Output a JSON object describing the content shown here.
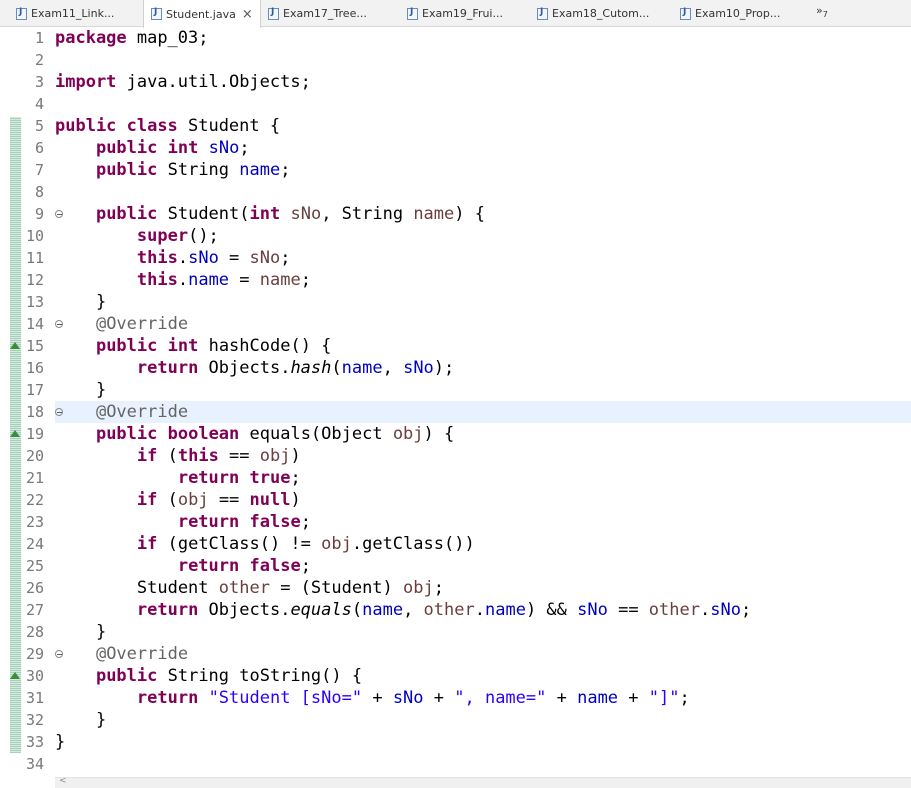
{
  "tabs": [
    {
      "label": "Exam11_Link...",
      "active": false
    },
    {
      "label": "Student.java",
      "active": true
    },
    {
      "label": "Exam17_Tree...",
      "active": false
    },
    {
      "label": "Exam19_Frui...",
      "active": false
    },
    {
      "label": "Exam18_Cutom...",
      "active": false
    },
    {
      "label": "Exam10_Prop...",
      "active": false
    }
  ],
  "overflow": {
    "symbol": "»",
    "count": "7"
  },
  "close_symbol": "×",
  "colors": {
    "keyword": "#7f0055",
    "field": "#0000c0",
    "local_variable": "#6a3e3e",
    "annotation": "#646464",
    "string": "#2a00ff",
    "current_line": "#e8f2fe",
    "change_bar": "#a8cfbe"
  },
  "editor": {
    "current_line_number": 18,
    "lines": [
      {
        "n": "1",
        "tokens": [
          [
            "kw",
            "package"
          ],
          [
            "",
            "map_03;"
          ]
        ]
      },
      {
        "n": "2",
        "tokens": []
      },
      {
        "n": "3",
        "tokens": [
          [
            "kw",
            "import"
          ],
          [
            "",
            "java.util.Objects;"
          ]
        ]
      },
      {
        "n": "4",
        "tokens": []
      },
      {
        "n": "5",
        "tokens": [
          [
            "kw",
            "public"
          ],
          [
            "",
            ""
          ],
          [
            "kw",
            "class"
          ],
          [
            "",
            "Student {"
          ]
        ]
      },
      {
        "n": "6",
        "tokens": [
          [
            "",
            "    "
          ],
          [
            "kw",
            "public"
          ],
          [
            "",
            " "
          ],
          [
            "kw",
            "int"
          ],
          [
            "",
            " "
          ],
          [
            "fld",
            "sNo"
          ],
          [
            "",
            ";"
          ]
        ]
      },
      {
        "n": "7",
        "tokens": [
          [
            "",
            "    "
          ],
          [
            "kw",
            "public"
          ],
          [
            "",
            " String "
          ],
          [
            "fld",
            "name"
          ],
          [
            "",
            ";"
          ]
        ]
      },
      {
        "n": "8",
        "tokens": []
      },
      {
        "n": "9",
        "fold": true,
        "tokens": [
          [
            "",
            "    "
          ],
          [
            "kw",
            "public"
          ],
          [
            "",
            " Student("
          ],
          [
            "kw",
            "int"
          ],
          [
            "",
            " "
          ],
          [
            "var",
            "sNo"
          ],
          [
            "",
            ", String "
          ],
          [
            "var",
            "name"
          ],
          [
            "",
            ") {"
          ]
        ]
      },
      {
        "n": "10",
        "tokens": [
          [
            "",
            "        "
          ],
          [
            "kw",
            "super"
          ],
          [
            "",
            "();"
          ]
        ]
      },
      {
        "n": "11",
        "tokens": [
          [
            "",
            "        "
          ],
          [
            "kw",
            "this"
          ],
          [
            "",
            "."
          ],
          [
            "fld",
            "sNo"
          ],
          [
            "",
            " = "
          ],
          [
            "var",
            "sNo"
          ],
          [
            "",
            ";"
          ]
        ]
      },
      {
        "n": "12",
        "tokens": [
          [
            "",
            "        "
          ],
          [
            "kw",
            "this"
          ],
          [
            "",
            "."
          ],
          [
            "fld",
            "name"
          ],
          [
            "",
            " = "
          ],
          [
            "var",
            "name"
          ],
          [
            "",
            ";"
          ]
        ]
      },
      {
        "n": "13",
        "tokens": [
          [
            "",
            "    }"
          ]
        ]
      },
      {
        "n": "14",
        "fold": true,
        "tokens": [
          [
            "",
            "    "
          ],
          [
            "ann",
            "@Override"
          ]
        ]
      },
      {
        "n": "15",
        "override": true,
        "tokens": [
          [
            "",
            "    "
          ],
          [
            "kw",
            "public"
          ],
          [
            "",
            " "
          ],
          [
            "kw",
            "int"
          ],
          [
            "",
            " hashCode() {"
          ]
        ]
      },
      {
        "n": "16",
        "tokens": [
          [
            "",
            "        "
          ],
          [
            "kw",
            "return"
          ],
          [
            "",
            " Objects."
          ],
          [
            "ital",
            "hash"
          ],
          [
            "",
            "("
          ],
          [
            "fld",
            "name"
          ],
          [
            "",
            ", "
          ],
          [
            "fld",
            "sNo"
          ],
          [
            "",
            ");"
          ]
        ]
      },
      {
        "n": "17",
        "tokens": [
          [
            "",
            "    }"
          ]
        ]
      },
      {
        "n": "18",
        "fold": true,
        "tokens": [
          [
            "",
            "    "
          ],
          [
            "ann",
            "@Override"
          ]
        ]
      },
      {
        "n": "19",
        "override": true,
        "tokens": [
          [
            "",
            "    "
          ],
          [
            "kw",
            "public"
          ],
          [
            "",
            " "
          ],
          [
            "kw",
            "boolean"
          ],
          [
            "",
            " equals(Object "
          ],
          [
            "var",
            "obj"
          ],
          [
            "",
            ") {"
          ]
        ]
      },
      {
        "n": "20",
        "tokens": [
          [
            "",
            "        "
          ],
          [
            "kw",
            "if"
          ],
          [
            "",
            " ("
          ],
          [
            "kw",
            "this"
          ],
          [
            "",
            " == "
          ],
          [
            "var",
            "obj"
          ],
          [
            "",
            ")"
          ]
        ]
      },
      {
        "n": "21",
        "tokens": [
          [
            "",
            "            "
          ],
          [
            "kw",
            "return"
          ],
          [
            "",
            " "
          ],
          [
            "kw",
            "true"
          ],
          [
            "",
            ";"
          ]
        ]
      },
      {
        "n": "22",
        "tokens": [
          [
            "",
            "        "
          ],
          [
            "kw",
            "if"
          ],
          [
            "",
            " ("
          ],
          [
            "var",
            "obj"
          ],
          [
            "",
            " == "
          ],
          [
            "kw",
            "null"
          ],
          [
            "",
            ")"
          ]
        ]
      },
      {
        "n": "23",
        "tokens": [
          [
            "",
            "            "
          ],
          [
            "kw",
            "return"
          ],
          [
            "",
            " "
          ],
          [
            "kw",
            "false"
          ],
          [
            "",
            ";"
          ]
        ]
      },
      {
        "n": "24",
        "tokens": [
          [
            "",
            "        "
          ],
          [
            "kw",
            "if"
          ],
          [
            "",
            " (getClass() != "
          ],
          [
            "var",
            "obj"
          ],
          [
            "",
            ".getClass())"
          ]
        ]
      },
      {
        "n": "25",
        "tokens": [
          [
            "",
            "            "
          ],
          [
            "kw",
            "return"
          ],
          [
            "",
            " "
          ],
          [
            "kw",
            "false"
          ],
          [
            "",
            ";"
          ]
        ]
      },
      {
        "n": "26",
        "tokens": [
          [
            "",
            "        Student "
          ],
          [
            "var",
            "other"
          ],
          [
            "",
            " = (Student) "
          ],
          [
            "var",
            "obj"
          ],
          [
            "",
            ";"
          ]
        ]
      },
      {
        "n": "27",
        "tokens": [
          [
            "",
            "        "
          ],
          [
            "kw",
            "return"
          ],
          [
            "",
            " Objects."
          ],
          [
            "ital",
            "equals"
          ],
          [
            "",
            "("
          ],
          [
            "fld",
            "name"
          ],
          [
            "",
            ", "
          ],
          [
            "var",
            "other"
          ],
          [
            "",
            "."
          ],
          [
            "fld",
            "name"
          ],
          [
            "",
            ") && "
          ],
          [
            "fld",
            "sNo"
          ],
          [
            "",
            " == "
          ],
          [
            "var",
            "other"
          ],
          [
            "",
            "."
          ],
          [
            "fld",
            "sNo"
          ],
          [
            "",
            ";"
          ]
        ]
      },
      {
        "n": "28",
        "tokens": [
          [
            "",
            "    }"
          ]
        ]
      },
      {
        "n": "29",
        "fold": true,
        "tokens": [
          [
            "",
            "    "
          ],
          [
            "ann",
            "@Override"
          ]
        ]
      },
      {
        "n": "30",
        "override": true,
        "tokens": [
          [
            "",
            "    "
          ],
          [
            "kw",
            "public"
          ],
          [
            "",
            " String toString() {"
          ]
        ]
      },
      {
        "n": "31",
        "tokens": [
          [
            "",
            "        "
          ],
          [
            "kw",
            "return"
          ],
          [
            "",
            " "
          ],
          [
            "str",
            "\"Student [sNo=\""
          ],
          [
            "",
            " + "
          ],
          [
            "fld",
            "sNo"
          ],
          [
            "",
            " + "
          ],
          [
            "str",
            "\", name=\""
          ],
          [
            "",
            " + "
          ],
          [
            "fld",
            "name"
          ],
          [
            "",
            " + "
          ],
          [
            "str",
            "\"]\""
          ],
          [
            "",
            ";"
          ]
        ]
      },
      {
        "n": "32",
        "tokens": [
          [
            "",
            "    }"
          ]
        ]
      },
      {
        "n": "33",
        "tokens": [
          [
            "",
            "}"
          ]
        ]
      },
      {
        "n": "34",
        "tokens": []
      }
    ]
  }
}
